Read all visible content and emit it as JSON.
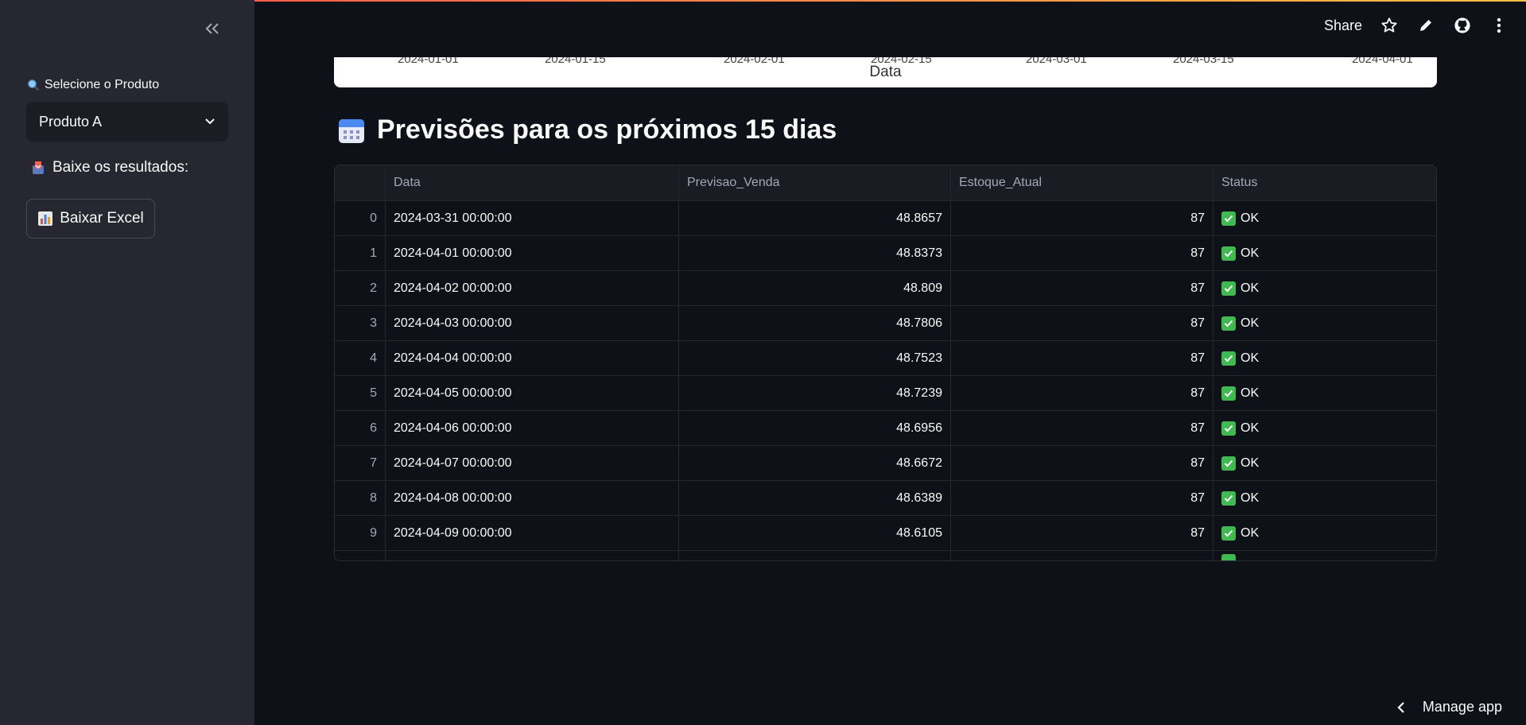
{
  "sidebar": {
    "select_label": "Selecione o Produto",
    "select_value": "Produto A",
    "download_label": "Baixe os resultados:",
    "download_button": "Baixar Excel"
  },
  "header": {
    "share": "Share"
  },
  "chart": {
    "xlabel": "Data",
    "ticks": [
      "2024-01-01",
      "2024-01-15",
      "2024-02-01",
      "2024-02-15",
      "2024-03-01",
      "2024-03-15",
      "2024-04-01"
    ]
  },
  "section": {
    "title": "Previsões para os próximos 15 dias"
  },
  "table": {
    "columns": [
      "",
      "Data",
      "Previsao_Venda",
      "Estoque_Atual",
      "Status"
    ],
    "rows": [
      {
        "idx": "0",
        "data": "2024-03-31 00:00:00",
        "prev": "48.8657",
        "est": "87",
        "status": "OK"
      },
      {
        "idx": "1",
        "data": "2024-04-01 00:00:00",
        "prev": "48.8373",
        "est": "87",
        "status": "OK"
      },
      {
        "idx": "2",
        "data": "2024-04-02 00:00:00",
        "prev": "48.809",
        "est": "87",
        "status": "OK"
      },
      {
        "idx": "3",
        "data": "2024-04-03 00:00:00",
        "prev": "48.7806",
        "est": "87",
        "status": "OK"
      },
      {
        "idx": "4",
        "data": "2024-04-04 00:00:00",
        "prev": "48.7523",
        "est": "87",
        "status": "OK"
      },
      {
        "idx": "5",
        "data": "2024-04-05 00:00:00",
        "prev": "48.7239",
        "est": "87",
        "status": "OK"
      },
      {
        "idx": "6",
        "data": "2024-04-06 00:00:00",
        "prev": "48.6956",
        "est": "87",
        "status": "OK"
      },
      {
        "idx": "7",
        "data": "2024-04-07 00:00:00",
        "prev": "48.6672",
        "est": "87",
        "status": "OK"
      },
      {
        "idx": "8",
        "data": "2024-04-08 00:00:00",
        "prev": "48.6389",
        "est": "87",
        "status": "OK"
      },
      {
        "idx": "9",
        "data": "2024-04-09 00:00:00",
        "prev": "48.6105",
        "est": "87",
        "status": "OK"
      }
    ]
  },
  "footer": {
    "manage": "Manage app"
  },
  "colors": {
    "sidebar_bg": "#262730",
    "main_bg": "#0e1117",
    "status_ok": "#3fb950"
  }
}
